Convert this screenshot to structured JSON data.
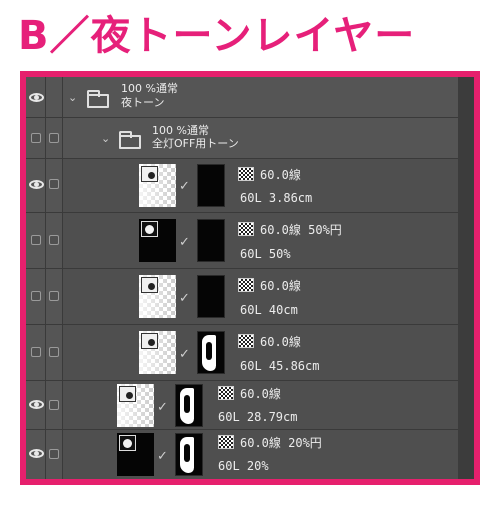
{
  "heading": "B／夜トーンレイヤー",
  "colors": {
    "accent": "#e6206d",
    "panel": "#4f4f4f",
    "selected": "#6d7c96"
  },
  "folders": [
    {
      "mode": "100 %通常",
      "name": "夜トーン",
      "eye": true,
      "selected": true
    },
    {
      "mode": "100 %通常",
      "name": "全灯OFF用トーン",
      "eye": false,
      "selected": false
    }
  ],
  "layers": [
    {
      "tone": "60.0線",
      "name": "60L 3.86cm",
      "eye": true,
      "thumb": "tone",
      "mask": "plain"
    },
    {
      "tone": "60.0線 50%円",
      "name": "60L 50%",
      "eye": false,
      "thumb": "black",
      "mask": "plain"
    },
    {
      "tone": "60.0線",
      "name": "60L 40cm",
      "eye": false,
      "thumb": "tone",
      "mask": "plain"
    },
    {
      "tone": "60.0線",
      "name": "60L 45.86cm",
      "eye": false,
      "thumb": "tone",
      "mask": "art"
    },
    {
      "tone": "60.0線",
      "name": "60L 28.79cm",
      "eye": true,
      "thumb": "tone",
      "mask": "art"
    },
    {
      "tone": "60.0線 20%円",
      "name": "60L 20%",
      "eye": true,
      "thumb": "black",
      "mask": "art"
    }
  ],
  "icons": {
    "visibility": "eye-icon",
    "edit": "pen-icon",
    "folder": "folder-icon",
    "tone": "screentone-icon",
    "expand": "chevron-down-icon"
  }
}
